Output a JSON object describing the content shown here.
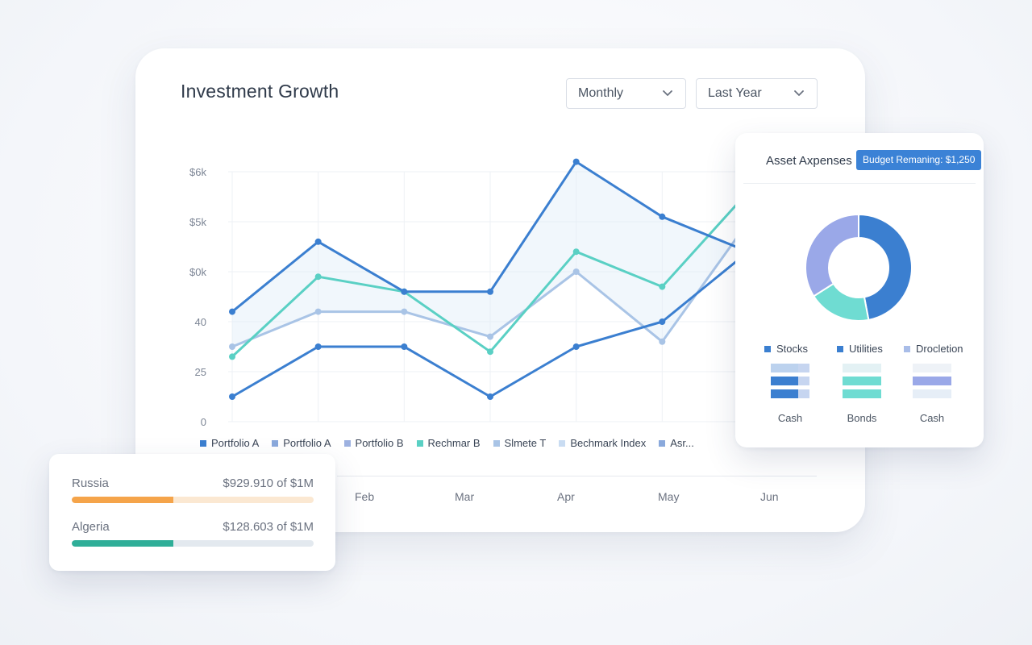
{
  "card": {
    "title": "Investment Growth",
    "frequency_select": {
      "value": "Monthly",
      "icon": "chevron-down-icon"
    },
    "range_select": {
      "value": "Last Year",
      "icon": "chevron-down-icon"
    }
  },
  "chart_data": {
    "type": "line",
    "x": [
      1,
      2,
      3,
      4,
      5,
      6,
      7
    ],
    "y_tick_labels": [
      "0",
      "25",
      "40",
      "$0k",
      "$5k",
      "$6k"
    ],
    "y_tick_values": [
      0,
      1,
      2,
      3,
      4,
      5
    ],
    "ylim": [
      0,
      5
    ],
    "xlim": [
      1,
      7
    ],
    "grid": true,
    "months": [
      "Feb",
      "Mar",
      "Apr",
      "May",
      "Jun"
    ],
    "series": [
      {
        "name": "Portfolio A",
        "color": "#3b7fd0",
        "values": [
          2.2,
          3.6,
          2.6,
          2.6,
          5.2,
          4.1,
          3.4
        ]
      },
      {
        "name": "Portfolio A",
        "color": "#5ad0c4",
        "values": [
          1.3,
          2.9,
          2.6,
          1.4,
          3.4,
          2.7,
          4.6
        ]
      },
      {
        "name": "Portfolio B",
        "color": "#a9c4e6",
        "values": [
          1.5,
          2.2,
          2.2,
          1.7,
          3.0,
          1.6,
          4.0
        ]
      },
      {
        "name": "Rechmar B",
        "color": "#3b7fd0",
        "values": [
          0.5,
          1.5,
          1.5,
          0.5,
          1.5,
          2.0,
          3.4
        ]
      }
    ],
    "legend": [
      {
        "label": "Portfolio A",
        "color": "#3b7fd0"
      },
      {
        "label": "Portfolio A",
        "color": "#8aa9dc"
      },
      {
        "label": "Portfolio B",
        "color": "#9db1e0"
      },
      {
        "label": "Rechmar B",
        "color": "#5ad0c4"
      },
      {
        "label": "Slmete T",
        "color": "#a9c4e6"
      },
      {
        "label": "Bechmark Index",
        "color": "#c9dcf2"
      },
      {
        "label": "Asr...",
        "color": "#8aa9dc"
      }
    ]
  },
  "asset_card": {
    "title": "Asset Axpenses",
    "budget_badge": "Budget Remaning: $1,250",
    "donut": {
      "slices": [
        {
          "label": "Stocks",
          "value": 0.47,
          "color": "#3b7fd0"
        },
        {
          "label": "Utilities",
          "value": 0.19,
          "color": "#6fdcd2"
        },
        {
          "label": "Drocletion",
          "value": 0.34,
          "color": "#9aa8e8"
        }
      ]
    },
    "legend": [
      {
        "label": "Stocks",
        "color": "#3b7fd0"
      },
      {
        "label": "Utilities",
        "color": "#3b7fd0"
      },
      {
        "label": "Drocletion",
        "color": "#a9bde8"
      }
    ],
    "bar_groups": [
      {
        "label": "Cash",
        "bars": [
          {
            "value": 0.7,
            "color": "#bcd2ee"
          },
          {
            "value": 0.7,
            "color": "#3b7fd0"
          },
          {
            "value": 0.7,
            "color": "#3b7fd0"
          }
        ]
      },
      {
        "label": "Bonds",
        "bars": [
          {
            "value": 1.0,
            "color": "#e3f1f4"
          },
          {
            "value": 1.0,
            "color": "#6fdcd2"
          },
          {
            "value": 1.0,
            "color": "#6fdcd2"
          }
        ]
      },
      {
        "label": "Cash",
        "bars": [
          {
            "value": 1.0,
            "color": "#eef2f7"
          },
          {
            "value": 1.0,
            "color": "#9aa8e8"
          },
          {
            "value": 1.0,
            "color": "#e6eef7"
          }
        ]
      }
    ]
  },
  "regions": [
    {
      "name": "Russia",
      "value": "$929.910 of $1M",
      "progress": 0.42,
      "color": "#f5a44a",
      "track": "#fbe8d2"
    },
    {
      "name": "Algeria",
      "value": "$128.603 of $1M",
      "progress": 0.42,
      "color": "#2fae98",
      "track": "#e3e9ef"
    }
  ]
}
